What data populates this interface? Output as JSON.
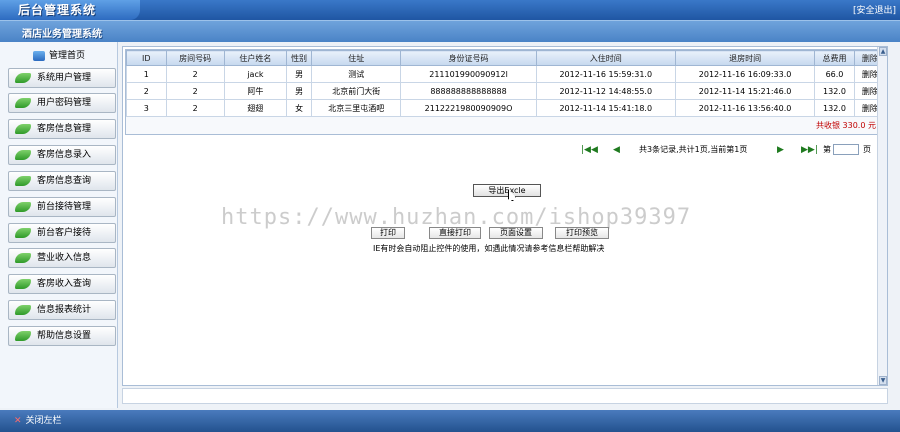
{
  "header": {
    "logo": "后台管理系统",
    "logout": "[安全退出]"
  },
  "subheader": {
    "title": "酒店业务管理系统"
  },
  "sidebar": {
    "home": "管理首页",
    "items": [
      {
        "label": "系统用户管理"
      },
      {
        "label": "用户密码管理"
      },
      {
        "label": "客房信息管理"
      },
      {
        "label": "客房信息录入"
      },
      {
        "label": "客房信息查询"
      },
      {
        "label": "前台接待管理"
      },
      {
        "label": "前台客户接待"
      },
      {
        "label": "营业收入信息"
      },
      {
        "label": "客房收入查询"
      },
      {
        "label": "信息报表统计"
      },
      {
        "label": "帮助信息设置"
      }
    ]
  },
  "table": {
    "headers": [
      "ID",
      "房间号码",
      "住户姓名",
      "性别",
      "住址",
      "身份证号码",
      "入住时间",
      "退房时间",
      "总费用",
      "删除"
    ],
    "rows": [
      [
        "1",
        "2",
        "jack",
        "男",
        "测试",
        "211101990090912l",
        "2012-11-16 15:59:31.0",
        "2012-11-16 16:09:33.0",
        "66.0",
        "删除"
      ],
      [
        "2",
        "2",
        "阿牛",
        "男",
        "北京前门大街",
        "888888888888888",
        "2012-11-12 14:48:55.0",
        "2012-11-14 15:21:46.0",
        "132.0",
        "删除"
      ],
      [
        "3",
        "2",
        "翅翅",
        "女",
        "北京三里屯酒吧",
        "2112221980090909O",
        "2012-11-14 15:41:18.0",
        "2012-11-16 13:56:40.0",
        "132.0",
        "删除"
      ]
    ],
    "total": "共收银 330.0 元"
  },
  "pager": {
    "text": "共3条记录,共计1页,当前第1页",
    "prefix": "第",
    "suffix": "页"
  },
  "actions": {
    "export": "导出Excle",
    "print": "打印",
    "direct_print": "直接打印",
    "page_setup": "页面设置",
    "print_preview": "打印预览",
    "ie_note": "IE有时会自动阻止控件的使用，如遇此情况请参考信息栏帮助解决"
  },
  "watermark": "https://www.huzhan.com/ishop39397",
  "footer": {
    "text": "关闭左栏"
  }
}
